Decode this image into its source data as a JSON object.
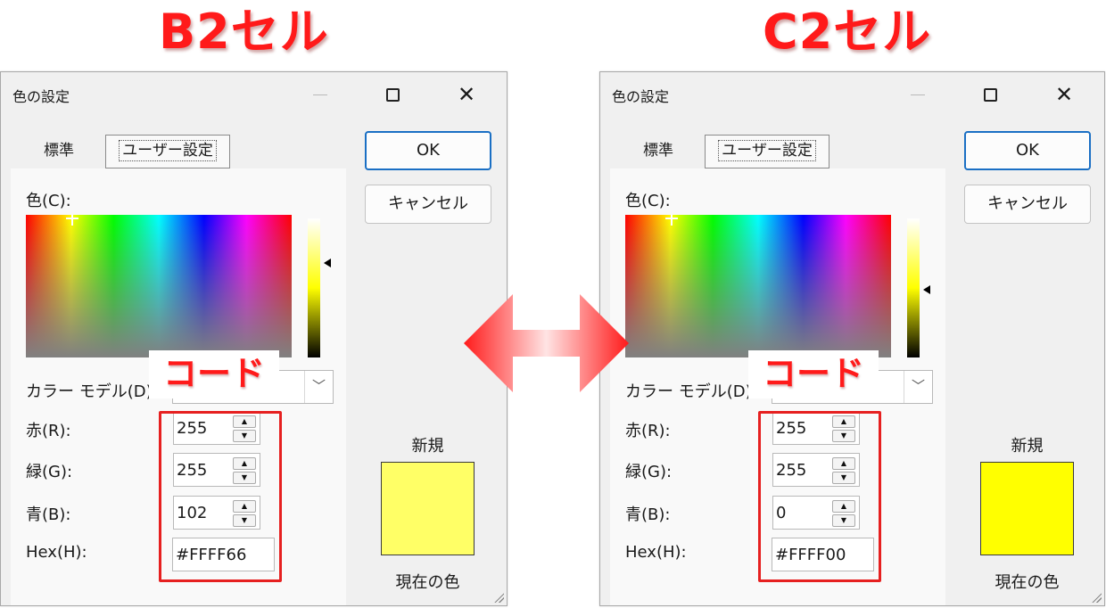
{
  "headings": {
    "left": "B2セル",
    "right": "C2セル"
  },
  "dialog_common": {
    "title": "色の設定",
    "tabs": {
      "standard": "標準",
      "custom": "ユーザー設定"
    },
    "buttons": {
      "ok": "OK",
      "cancel": "キャンセル"
    },
    "labels": {
      "color": "色(C):",
      "color_model": "カラー モデル(D):",
      "red": "赤(R):",
      "green": "緑(G):",
      "blue": "青(B):",
      "hex": "Hex(H):",
      "new": "新規",
      "current": "現在の色"
    },
    "annotation": "コード"
  },
  "dialogs": {
    "left": {
      "red": "255",
      "green": "255",
      "blue": "102",
      "hex": "#FFFF66",
      "swatch_color": "#FFFF66",
      "lum_level_percent": 68
    },
    "right": {
      "red": "255",
      "green": "255",
      "blue": "0",
      "hex": "#FFFF00",
      "swatch_color": "#FFFF00",
      "lum_level_percent": 49
    }
  },
  "colors": {
    "annotation_red": "#FF1A1A",
    "ok_focus_border": "#1A6FC4"
  },
  "icons": {
    "center_arrow": "double-headed-arrow-icon",
    "minimize": "minimize-icon",
    "maximize": "maximize-icon",
    "close": "close-icon",
    "combo": "chevron-down-icon"
  }
}
